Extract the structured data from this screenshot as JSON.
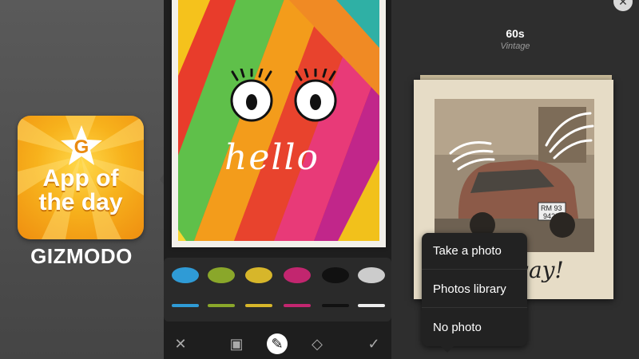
{
  "badge": {
    "letter": "G",
    "title": "App of the day",
    "title_lines": [
      "App of",
      "the day"
    ]
  },
  "brand": "GIZMODO",
  "drawing": {
    "text": "hello"
  },
  "palette": {
    "colors": [
      "#2f9bd6",
      "#8aa72a",
      "#d7b62a",
      "#c2266f",
      "#111111",
      "#cccccc"
    ]
  },
  "toolbar": {
    "tools": [
      {
        "name": "close",
        "glyph": "✕"
      },
      {
        "name": "image",
        "glyph": "▣"
      },
      {
        "name": "brush",
        "glyph": "✎"
      },
      {
        "name": "eraser",
        "glyph": "◇"
      },
      {
        "name": "confirm",
        "glyph": "✓"
      }
    ]
  },
  "filter": {
    "name": "60s",
    "subtitle": "Vintage"
  },
  "photo": {
    "plate": "RM 93\n9429",
    "caption": "way!"
  },
  "close_glyph": "✕",
  "menu": {
    "items": [
      "Take a photo",
      "Photos library",
      "No photo"
    ]
  }
}
